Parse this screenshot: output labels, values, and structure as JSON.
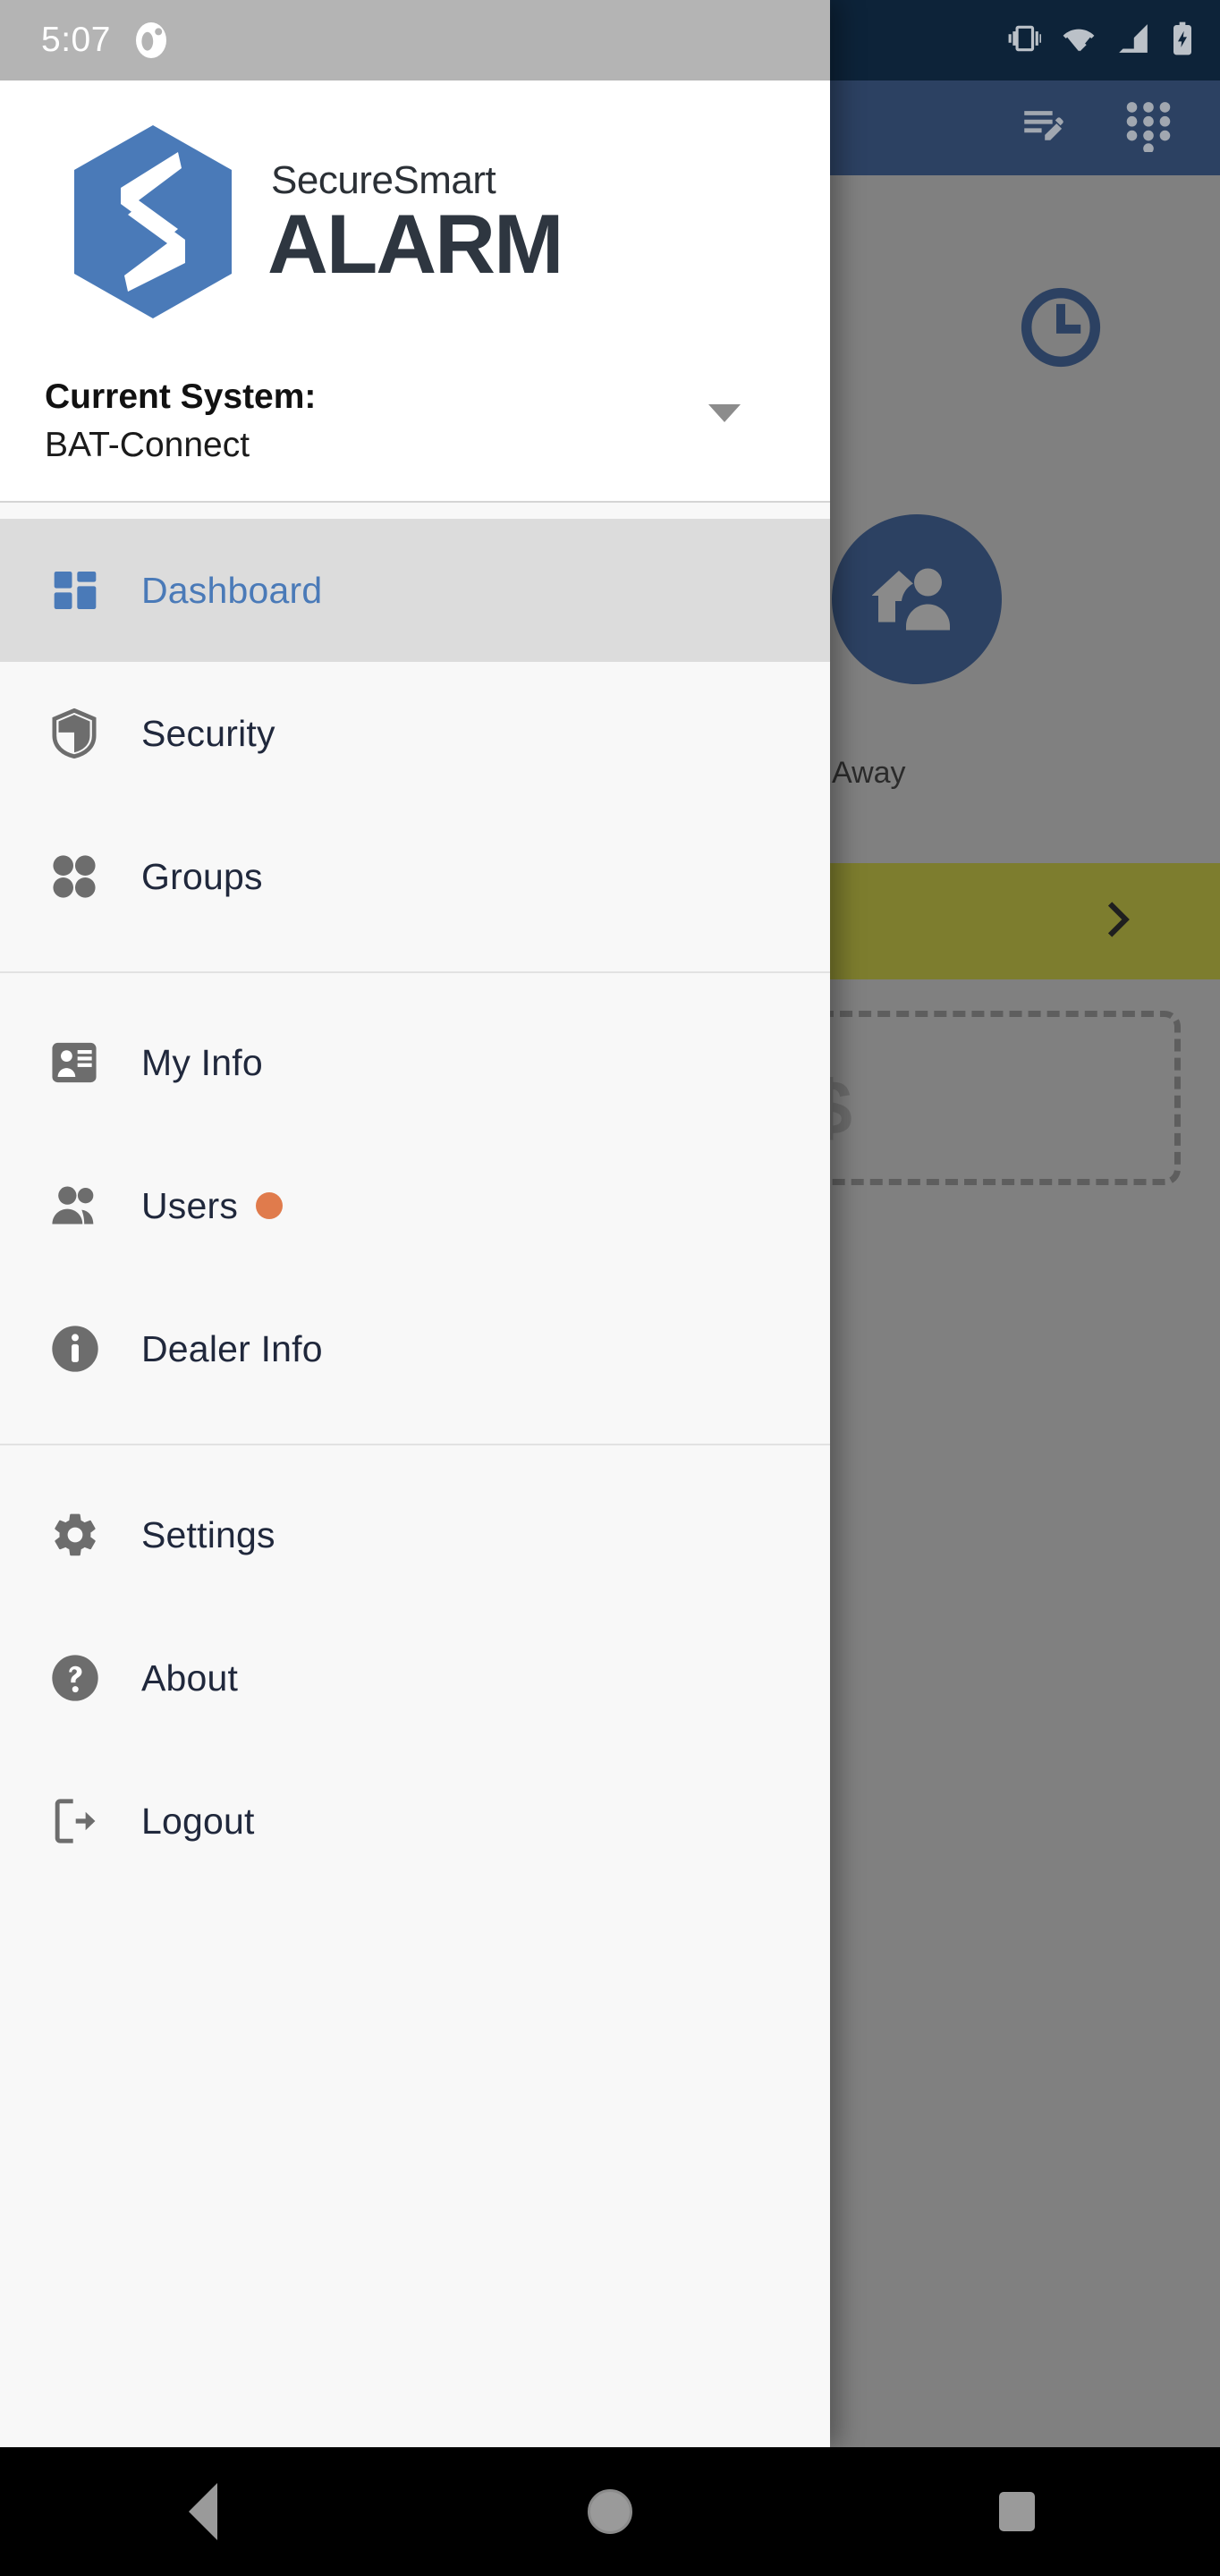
{
  "status_bar": {
    "time": "5:07",
    "notification_icon": "app-notification-icon",
    "vibrate_icon": "vibrate-icon",
    "wifi_icon": "wifi-icon",
    "cellular_icon": "cellular-signal-icon",
    "battery_icon": "battery-charging-icon"
  },
  "brand": {
    "logo_icon": "securesmart-hex-s-logo",
    "name_top": "SecureSmart",
    "name_bottom": "ALARM",
    "logo_blue": "#4a7ab8",
    "wordmark_dark": "#2e3640"
  },
  "system_selector": {
    "label": "Current System:",
    "value": "BAT-Connect",
    "caret_icon": "chevron-down-icon"
  },
  "menu": {
    "groups": [
      {
        "items": [
          {
            "label": "Dashboard",
            "icon": "dashboard-grid-icon",
            "active": true,
            "badge": false
          },
          {
            "label": "Security",
            "icon": "shield-icon",
            "active": false,
            "badge": false
          },
          {
            "label": "Groups",
            "icon": "groups-dots-icon",
            "active": false,
            "badge": false
          }
        ]
      },
      {
        "items": [
          {
            "label": "My Info",
            "icon": "contact-card-icon",
            "active": false,
            "badge": false
          },
          {
            "label": "Users",
            "icon": "people-icon",
            "active": false,
            "badge": true
          },
          {
            "label": "Dealer Info",
            "icon": "info-circle-icon",
            "active": false,
            "badge": false
          }
        ]
      },
      {
        "items": [
          {
            "label": "Settings",
            "icon": "gear-icon",
            "active": false,
            "badge": false
          },
          {
            "label": "About",
            "icon": "question-circle-icon",
            "active": false,
            "badge": false
          },
          {
            "label": "Logout",
            "icon": "logout-exit-icon",
            "active": false,
            "badge": false
          }
        ]
      }
    ],
    "active_color": "#4a7ab8",
    "label_color": "#20283c",
    "badge_color": "#e07b4c",
    "active_row_bg": "#dcdcdc"
  },
  "background_app": {
    "appbar_color": "#2c4162",
    "edit_list_icon": "edit-list-icon",
    "keypad_icon": "keypad-dots-icon",
    "clock_icon": "clock-icon",
    "away_icon": "house-person-away-icon",
    "away_label": "Away",
    "banner_color": "#7d7d2e",
    "banner_chevron_icon": "chevron-right-icon",
    "dollar_text": "$"
  },
  "nav_bar": {
    "back_icon": "back-triangle-icon",
    "home_icon": "home-circle-icon",
    "recents_icon": "recents-square-icon"
  }
}
